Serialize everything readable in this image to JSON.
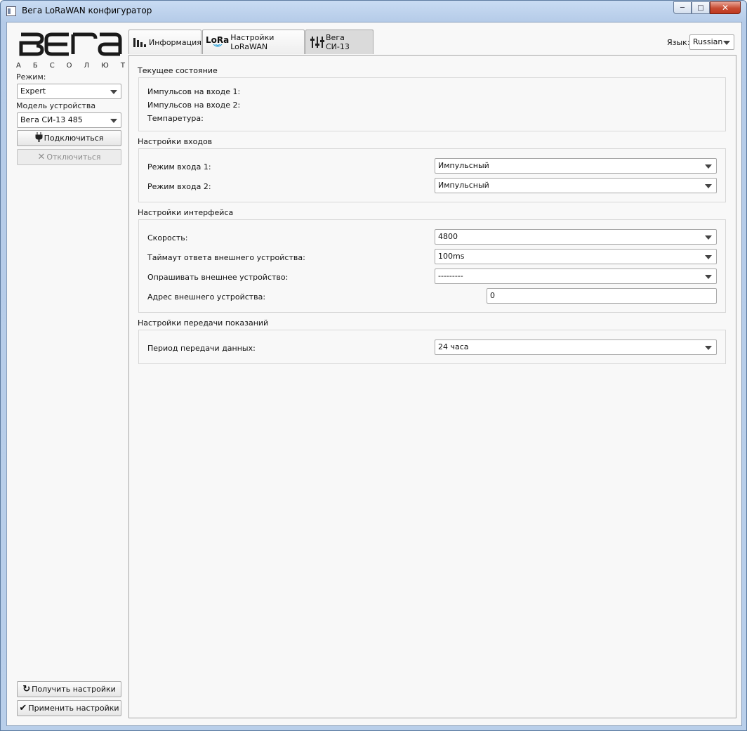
{
  "window": {
    "title": "Вега LoRaWAN конфигуратор"
  },
  "sidebar": {
    "logo_text": "ВЕГА",
    "logo_sub": [
      "А",
      "Б",
      "С",
      "О",
      "Л",
      "Ю",
      "Т"
    ],
    "mode_label": "Режим:",
    "mode_value": "Expert",
    "model_label": "Модель устройства",
    "model_value": "Вега СИ-13 485",
    "connect_label": "Подключиться",
    "disconnect_label": "Отключиться",
    "get_settings_label": "Получить настройки",
    "apply_settings_label": "Применить настройки"
  },
  "tabs": [
    {
      "label": "Информация",
      "icon": "bar-chart-icon"
    },
    {
      "label": "Настройки LoRaWAN",
      "icon": "lora-icon",
      "icon_text": "LoRa"
    },
    {
      "label": "Вега СИ-13",
      "icon": "sliders-icon"
    }
  ],
  "language": {
    "label": "Язык:",
    "value": "Russian"
  },
  "current_state": {
    "title": "Текущее состояние",
    "rows": [
      "Импульсов на входе 1:",
      "Импульсов на входе 2:",
      "Темпаретура:"
    ]
  },
  "inputs": {
    "title": "Настройки входов",
    "input1_label": "Режим входа 1:",
    "input1_value": "Импульсный",
    "input2_label": "Режим входа 2:",
    "input2_value": "Импульсный"
  },
  "interface": {
    "title": "Настройки интерфейса",
    "speed_label": "Скорость:",
    "speed_value": "4800",
    "timeout_label": "Таймаут ответа внешнего устройства:",
    "timeout_value": "100ms",
    "poll_label": "Опрашивать внешнее устройство:",
    "poll_value": "---------",
    "address_label": "Адрес внешнего устройства:",
    "address_value": "0"
  },
  "transmission": {
    "title": "Настройки передачи показаний",
    "period_label": "Период передачи данных:",
    "period_value": "24 часа"
  }
}
